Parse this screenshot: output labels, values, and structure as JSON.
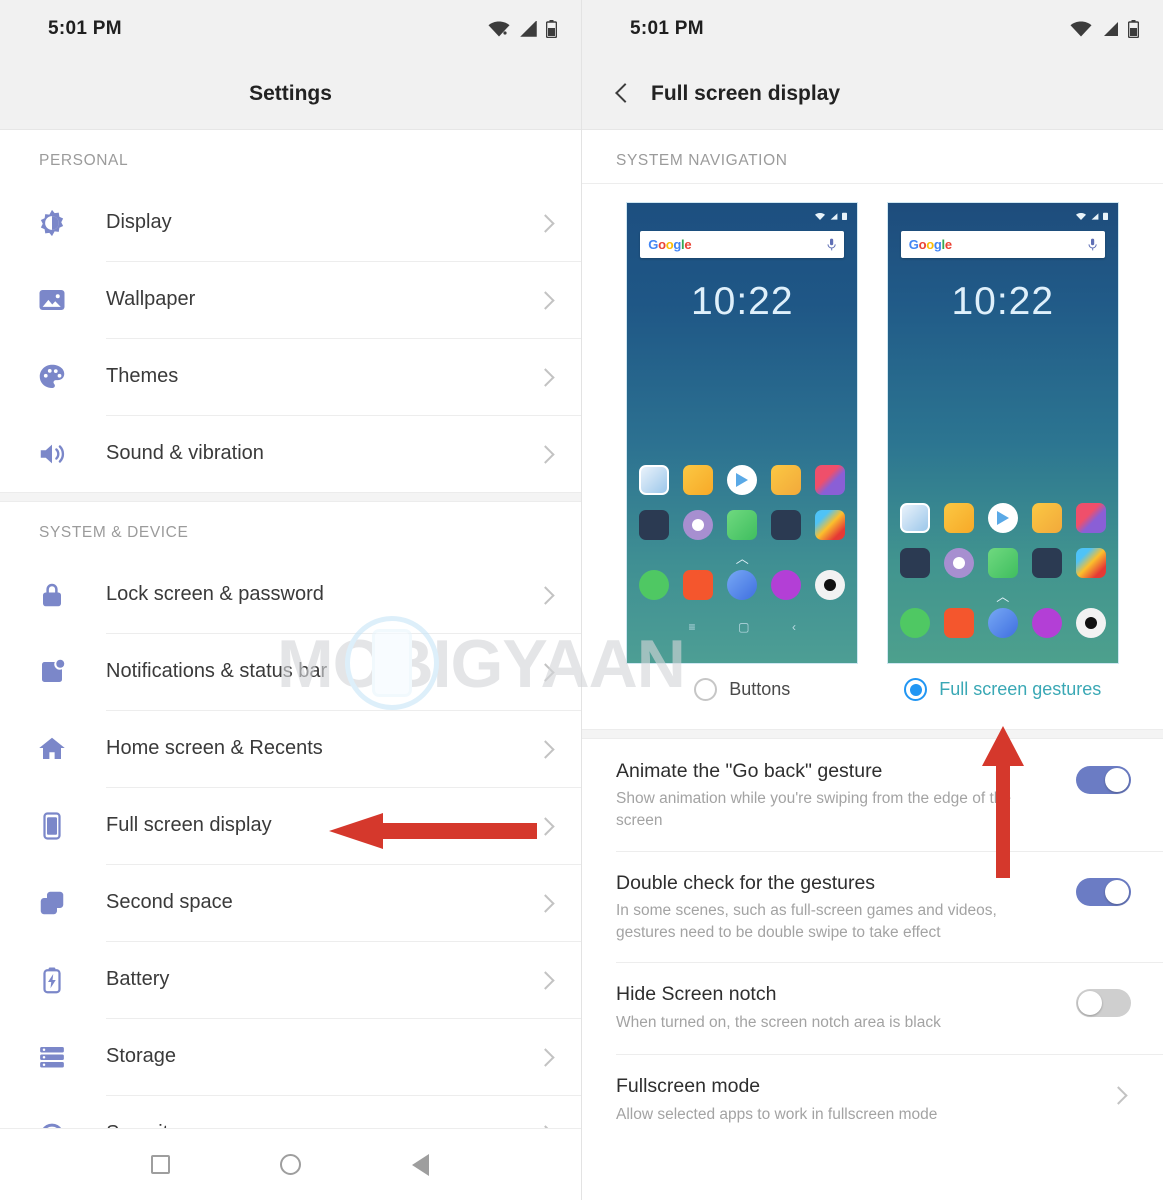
{
  "colors": {
    "accent_icon": "#7b87c9",
    "toggle_on": "#6b7cc4",
    "toggle_off": "#cfcfcf",
    "radio_on": "#2196f3",
    "selected_label": "#3aa8b5",
    "annotation_red": "#d5382c",
    "statusbar_bg": "#f1f1f1"
  },
  "left_screen": {
    "statusbar": {
      "time": "5:01 PM",
      "icons": [
        "wifi-icon",
        "signal-icon",
        "battery-icon"
      ]
    },
    "appbar": {
      "title": "Settings"
    },
    "sections": [
      {
        "label": "PERSONAL",
        "items": [
          {
            "label": "Display",
            "icon": "brightness-icon"
          },
          {
            "label": "Wallpaper",
            "icon": "image-icon"
          },
          {
            "label": "Themes",
            "icon": "palette-icon"
          },
          {
            "label": "Sound & vibration",
            "icon": "speaker-icon"
          }
        ]
      },
      {
        "label": "SYSTEM & DEVICE",
        "items": [
          {
            "label": "Lock screen & password",
            "icon": "lock-icon"
          },
          {
            "label": "Notifications & status bar",
            "icon": "notification-icon"
          },
          {
            "label": "Home screen & Recents",
            "icon": "home-icon"
          },
          {
            "label": "Full screen display",
            "icon": "phone-icon"
          },
          {
            "label": "Second space",
            "icon": "copy-icon"
          },
          {
            "label": "Battery",
            "icon": "battery-bolt-icon"
          },
          {
            "label": "Storage",
            "icon": "storage-icon"
          },
          {
            "label": "Security",
            "icon": "shield-icon"
          }
        ]
      }
    ],
    "navbar": {
      "recents": "square-icon",
      "home": "circle-icon",
      "back": "triangle-icon"
    }
  },
  "right_screen": {
    "statusbar": {
      "time": "5:01 PM",
      "icons": [
        "wifi-icon",
        "signal-icon",
        "battery-icon"
      ]
    },
    "appbar": {
      "title": "Full screen display",
      "back": "back-chevron-icon"
    },
    "section_label": "SYSTEM NAVIGATION",
    "navigation_options": [
      {
        "label": "Buttons",
        "selected": false,
        "preview_clock": "10:22",
        "preview_search": "Google",
        "has_navbar": true
      },
      {
        "label": "Full screen gestures",
        "selected": true,
        "preview_clock": "10:22",
        "preview_search": "Google",
        "has_navbar": false
      }
    ],
    "settings": [
      {
        "title": "Animate the \"Go back\" gesture",
        "subtitle": "Show animation while you're swiping from the edge of the screen",
        "control": "toggle",
        "value": "on"
      },
      {
        "title": "Double check for the gestures",
        "subtitle": "In some scenes, such as full-screen games and videos, gestures need to be double swipe to take effect",
        "control": "toggle",
        "value": "on"
      },
      {
        "title": "Hide Screen notch",
        "subtitle": "When turned on, the screen notch area is black",
        "control": "toggle",
        "value": "off"
      },
      {
        "title": "Fullscreen mode",
        "subtitle": "Allow selected apps to work in fullscreen mode",
        "control": "chevron",
        "value": ""
      }
    ]
  },
  "watermark": {
    "text": "MOBIGYAAN",
    "prefix": "M",
    "suffix": "BIGYAAN"
  }
}
